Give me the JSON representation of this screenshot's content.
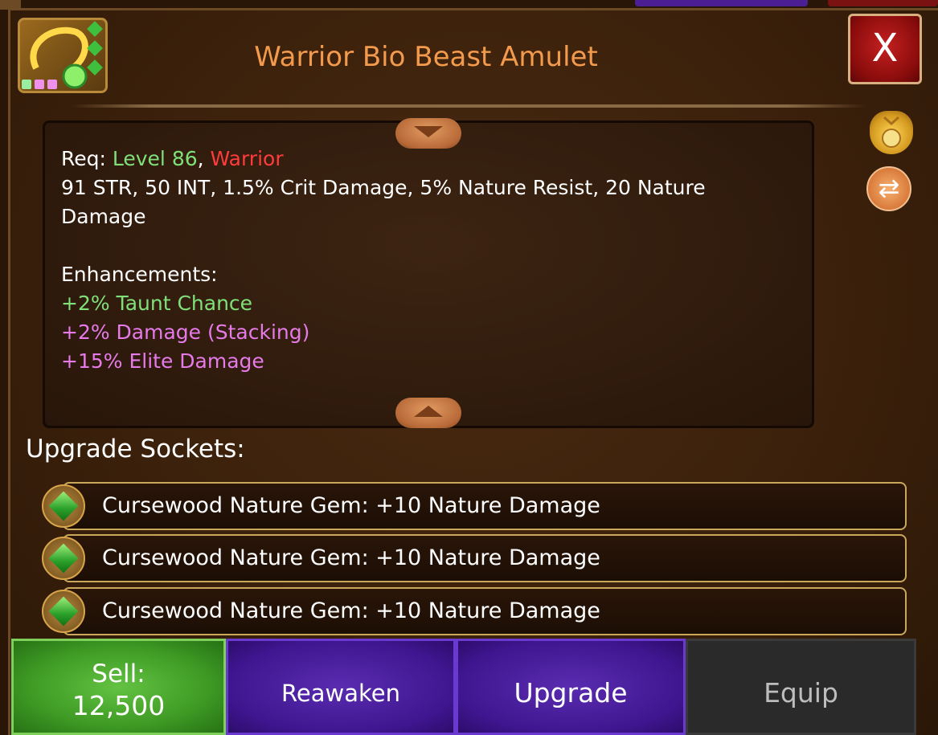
{
  "title": "Warrior Bio Beast Amulet",
  "close_label": "X",
  "requirements": {
    "prefix": "Req: ",
    "level": "Level 86",
    "separator": ", ",
    "class": "Warrior"
  },
  "stats": "91 STR, 50 INT, 1.5% Crit Damage, 5% Nature Resist, 20 Nature Damage",
  "enhancements": {
    "heading": "Enhancements:",
    "items": [
      "+2% Taunt Chance",
      "+2% Damage (Stacking)",
      "+15% Elite Damage"
    ]
  },
  "sockets": {
    "heading": "Upgrade Sockets:",
    "items": [
      "Cursewood Nature Gem: +10 Nature Damage",
      "Cursewood Nature Gem: +10 Nature Damage",
      "Cursewood Nature Gem: +10 Nature Damage"
    ]
  },
  "actions": {
    "sell_label": "Sell:",
    "sell_price": "12,500",
    "reawaken": "Reawaken",
    "upgrade": "Upgrade",
    "equip": "Equip"
  },
  "icons": {
    "item": "amulet-icon",
    "side_top": "gold-bag-icon",
    "side_bottom": "swap-icon",
    "socket": "nature-gem-icon"
  },
  "colors": {
    "title": "#f39a4c",
    "level": "#7fe07a",
    "class": "#ff3b3b",
    "enh_green": "#7fe07a",
    "enh_purple": "#e57ae8"
  }
}
